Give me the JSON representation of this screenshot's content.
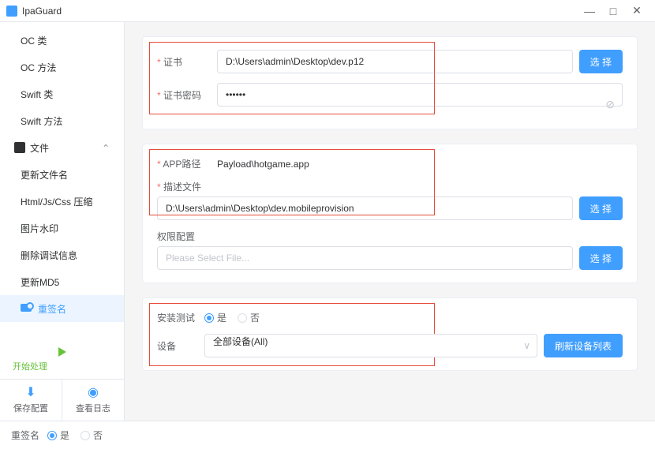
{
  "app": {
    "title": "IpaGuard"
  },
  "win_buttons": {
    "min": "—",
    "max": "□",
    "close": "✕"
  },
  "sidebar": {
    "items": [
      {
        "label": "OC 类"
      },
      {
        "label": "OC 方法"
      },
      {
        "label": "Swift 类"
      },
      {
        "label": "Swift 方法"
      }
    ],
    "group": {
      "label": "文件"
    },
    "subitems": [
      {
        "label": "更新文件名"
      },
      {
        "label": "Html/Js/Css 压缩"
      },
      {
        "label": "图片水印"
      },
      {
        "label": "删除调试信息"
      },
      {
        "label": "更新MD5"
      }
    ],
    "active": {
      "label": "重签名"
    },
    "start": {
      "label": "开始处理"
    },
    "bottom": [
      {
        "icon": "⬇",
        "label": "保存配置"
      },
      {
        "icon": "◉",
        "label": "查看日志"
      }
    ]
  },
  "card1": {
    "cert_label": "证书",
    "cert_value": "D:\\Users\\admin\\Desktop\\dev.p12",
    "select_btn": "选 择",
    "pwd_label": "证书密码",
    "pwd_value": "••••••"
  },
  "card2": {
    "app_path_label": "APP路径",
    "app_path_value": "Payload\\hotgame.app",
    "profile_label": "描述文件",
    "profile_value": "D:\\Users\\admin\\Desktop\\dev.mobileprovision",
    "select_btn": "选 择",
    "perm_label": "权限配置",
    "perm_placeholder": "Please Select File..."
  },
  "card3": {
    "install_label": "安装测试",
    "opt_yes": "是",
    "opt_no": "否",
    "device_label": "设备",
    "device_value": "全部设备(All)",
    "refresh_btn": "刷新设备列表"
  },
  "footer": {
    "resign_label": "重签名",
    "opt_yes": "是",
    "opt_no": "否"
  }
}
